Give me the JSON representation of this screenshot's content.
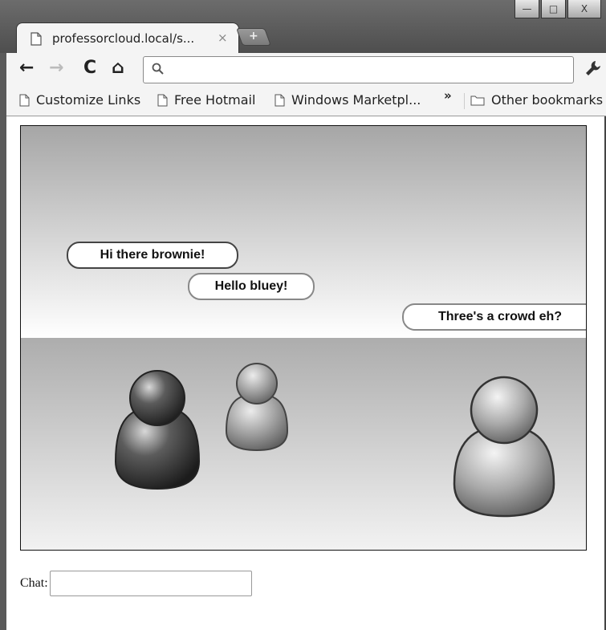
{
  "window": {
    "minimize_symbol": "—",
    "maximize_symbol": "□",
    "close_symbol": "X"
  },
  "tab": {
    "title": "professorcloud.local/s...",
    "close_symbol": "×",
    "new_tab_symbol": "+"
  },
  "toolbar": {
    "back_symbol": "←",
    "forward_symbol": "→",
    "reload_symbol": "C",
    "home_symbol": "⌂",
    "address_value": "",
    "address_placeholder": ""
  },
  "bookmarks": {
    "items": [
      {
        "label": "Customize Links"
      },
      {
        "label": "Free Hotmail"
      },
      {
        "label": "Windows Marketpl..."
      }
    ],
    "overflow_symbol": "»",
    "other_label": "Other bookmarks"
  },
  "stage": {
    "speech": [
      {
        "text": "Hi there brownie!"
      },
      {
        "text": "Hello bluey!"
      },
      {
        "text": "Three's a crowd eh?"
      }
    ]
  },
  "chat": {
    "label": "Chat:",
    "value": ""
  }
}
